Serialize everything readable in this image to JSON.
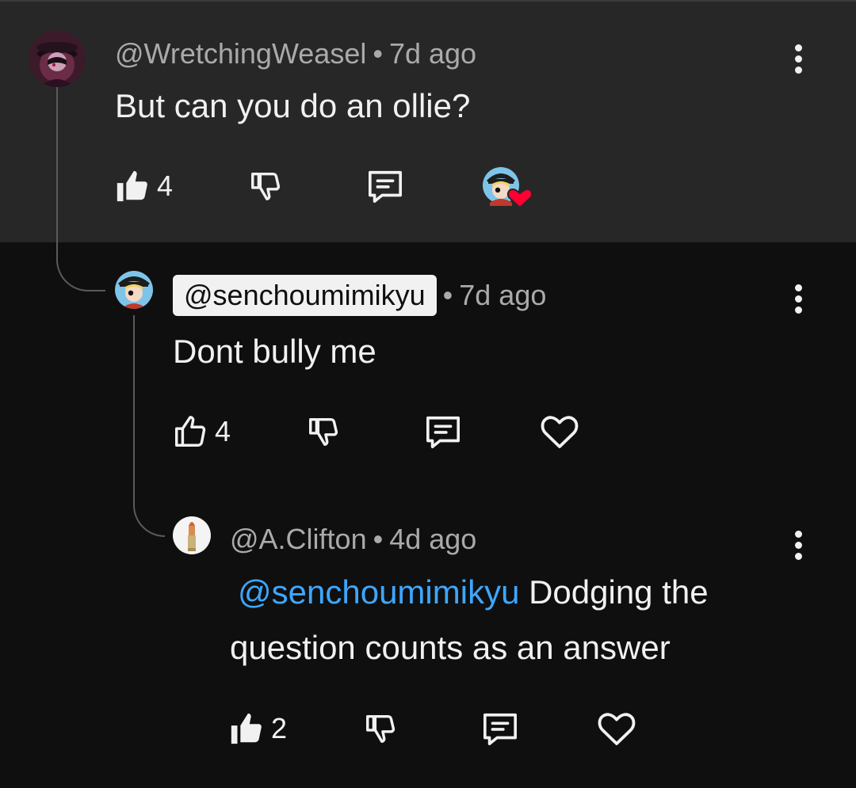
{
  "comments": [
    {
      "handle": "@WretchingWeasel",
      "time": "7d ago",
      "text": "But can you do an ollie?",
      "likes": "4",
      "liked": true,
      "creator_hearted": true
    },
    {
      "handle": "@senchoumimikyu",
      "time": "7d ago",
      "text": "Dont bully me",
      "likes": "4",
      "liked": false,
      "highlighted_handle": true
    },
    {
      "handle": "@A.Clifton",
      "time": "4d ago",
      "mention": "@senchoumimikyu",
      "text_after_mention": " Dodging the",
      "text_line2": "question counts as an answer",
      "likes": "2",
      "liked": true
    }
  ],
  "separator": "•",
  "icons": {
    "like": "thumbs-up-icon",
    "dislike": "thumbs-down-icon",
    "reply": "reply-comment-icon",
    "heart": "heart-icon",
    "more": "more-vert-icon"
  },
  "colors": {
    "background": "#0f0f0f",
    "highlight_background": "#272727",
    "text": "#f1f1f1",
    "meta": "#aaaaaa",
    "mention": "#3ea6ff",
    "creator_heart": "#ff0033"
  }
}
